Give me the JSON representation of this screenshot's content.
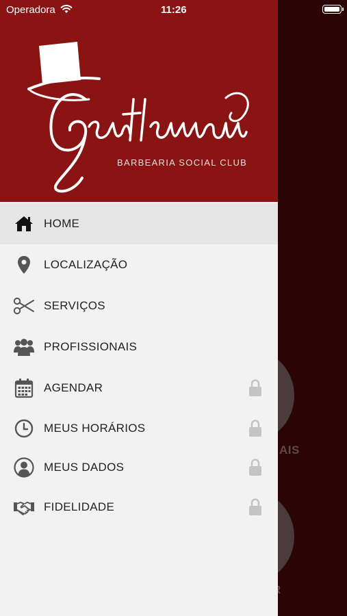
{
  "status_bar": {
    "carrier": "Operadora",
    "time": "11:26"
  },
  "brand": {
    "name": "Gentleman",
    "subtitle": "BARBEARIA SOCIAL CLUB",
    "header_color": "#8a1414"
  },
  "menu": {
    "items": [
      {
        "label": "HOME",
        "icon": "home-icon",
        "active": true,
        "locked": false
      },
      {
        "label": "LOCALIZAÇÃO",
        "icon": "location-pin-icon",
        "active": false,
        "locked": false
      },
      {
        "label": "SERVIÇOS",
        "icon": "scissors-icon",
        "active": false,
        "locked": false
      },
      {
        "label": "PROFISSIONAIS",
        "icon": "group-icon",
        "active": false,
        "locked": false
      },
      {
        "label": "AGENDAR",
        "icon": "calendar-icon",
        "active": false,
        "locked": true
      },
      {
        "label": "MEUS HORÁRIOS",
        "icon": "clock-icon",
        "active": false,
        "locked": true
      },
      {
        "label": "MEUS DADOS",
        "icon": "user-circle-icon",
        "active": false,
        "locked": true
      },
      {
        "label": "FIDELIDADE",
        "icon": "handshake-icon",
        "active": false,
        "locked": true
      }
    ]
  },
  "background": {
    "text_1": "AIS",
    "text_2": "R"
  }
}
